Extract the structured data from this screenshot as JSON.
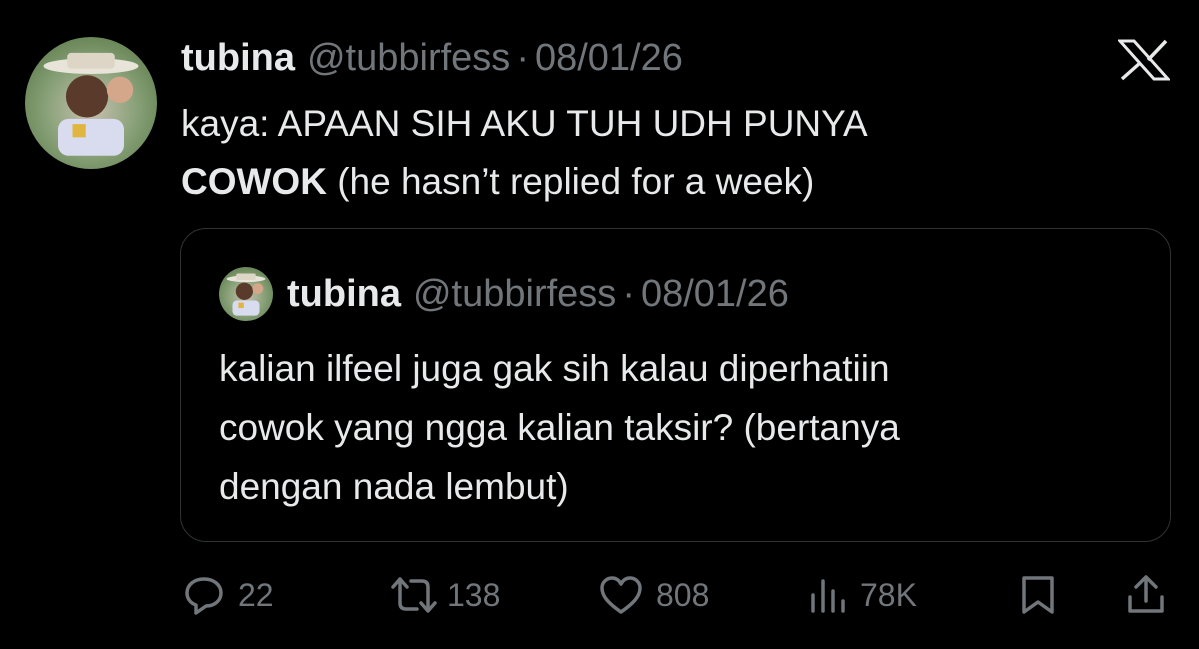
{
  "tweet": {
    "author": {
      "name": "tubina",
      "handle": "@tubbirfess",
      "separator": "·",
      "date": "08/01/26",
      "avatar_icon": "profile-avatar"
    },
    "text_line1": "kaya: APAAN SIH AKU TUH UDH PUNYA",
    "text_bold": "COWOK",
    "text_rest": " (he hasn’t replied for a week)"
  },
  "quote": {
    "author": {
      "name": "tubina",
      "handle": "@tubbirfess",
      "separator": "·",
      "date": "08/01/26"
    },
    "text_line1": "kalian ilfeel juga gak sih kalau diperhatiin",
    "text_line2": "cowok yang ngga kalian taksir? (bertanya",
    "text_line3": "dengan nada lembut)"
  },
  "actions": {
    "replies": "22",
    "retweets": "138",
    "likes": "808",
    "views": "78K"
  },
  "icons": [
    "x-logo-icon",
    "reply-icon",
    "retweet-icon",
    "like-icon",
    "views-icon",
    "bookmark-icon",
    "share-icon"
  ],
  "colors": {
    "background": "#000000",
    "primary_text": "#e7e9ea",
    "secondary_text": "#71767b",
    "border": "#2f3336"
  }
}
